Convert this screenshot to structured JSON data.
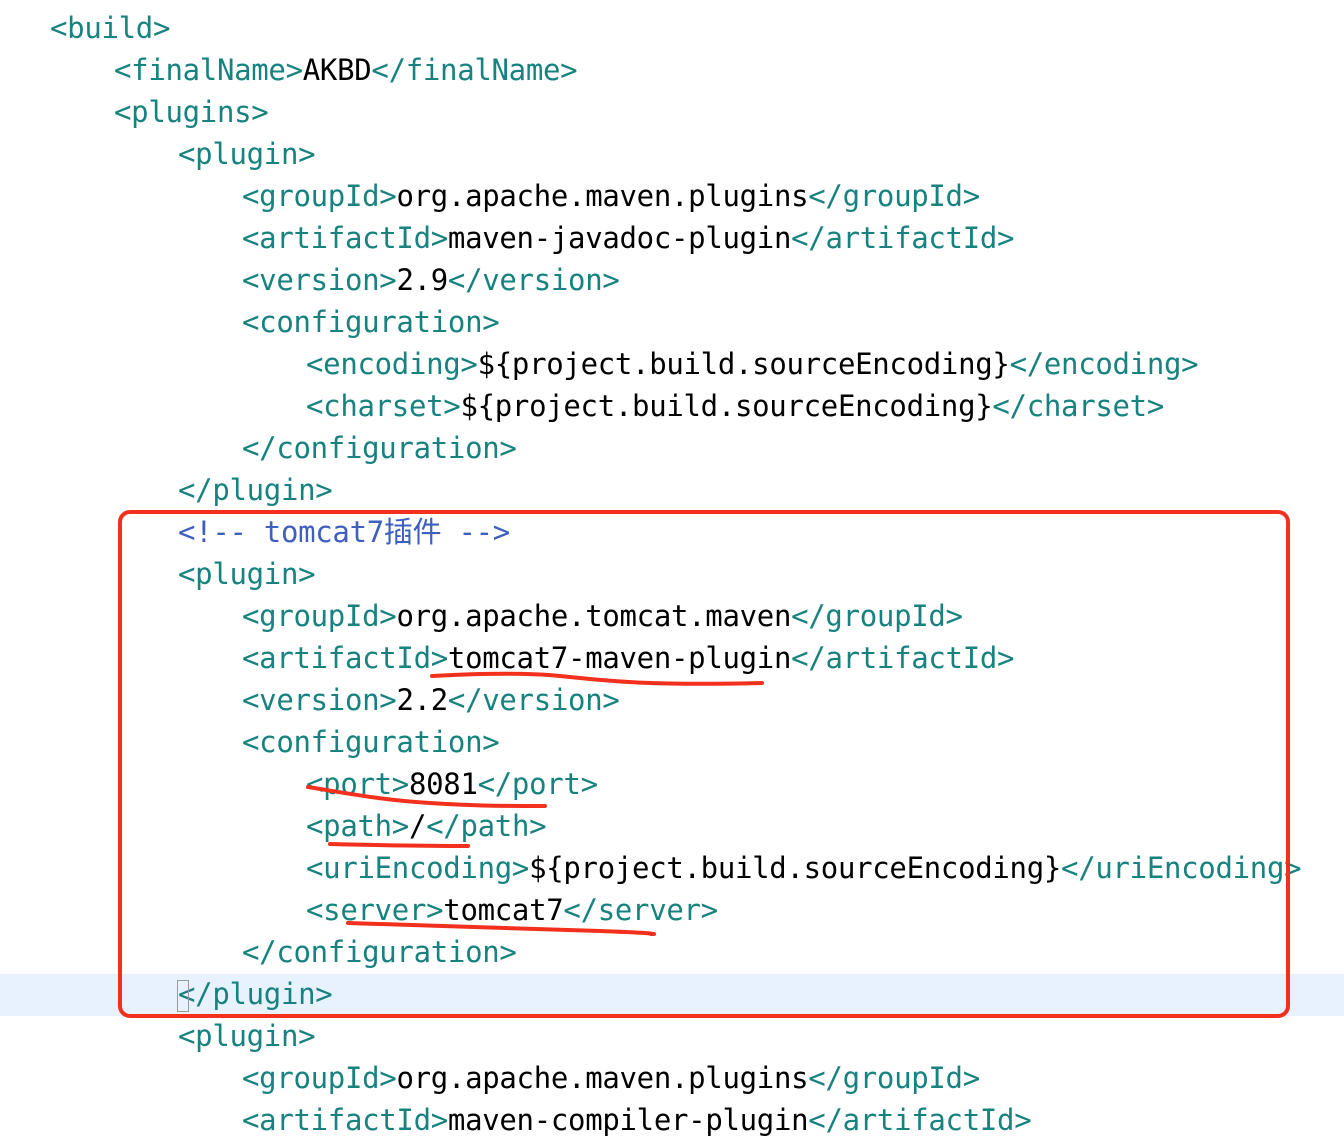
{
  "editor": {
    "lines": [
      {
        "indent": 0,
        "open": "build"
      },
      {
        "indent": 1,
        "open": "finalName",
        "value": "AKBD"
      },
      {
        "indent": 1,
        "open": "plugins"
      },
      {
        "indent": 2,
        "open": "plugin"
      },
      {
        "indent": 3,
        "open": "groupId",
        "value": "org.apache.maven.plugins"
      },
      {
        "indent": 3,
        "open": "artifactId",
        "value": "maven-javadoc-plugin"
      },
      {
        "indent": 3,
        "open": "version",
        "value": "2.9"
      },
      {
        "indent": 3,
        "open": "configuration"
      },
      {
        "indent": 4,
        "open": "encoding",
        "value": "${project.build.sourceEncoding}"
      },
      {
        "indent": 4,
        "open": "charset",
        "value": "${project.build.sourceEncoding}"
      },
      {
        "indent": 3,
        "close": "configuration"
      },
      {
        "indent": 2,
        "close": "plugin"
      },
      {
        "indent": 2,
        "comment": "<!-- tomcat7插件 -->"
      },
      {
        "indent": 2,
        "open": "plugin"
      },
      {
        "indent": 3,
        "open": "groupId",
        "value": "org.apache.tomcat.maven"
      },
      {
        "indent": 3,
        "open": "artifactId",
        "value": "tomcat7-maven-plugin"
      },
      {
        "indent": 3,
        "open": "version",
        "value": "2.2"
      },
      {
        "indent": 3,
        "open": "configuration"
      },
      {
        "indent": 4,
        "open": "port",
        "value": "8081"
      },
      {
        "indent": 4,
        "open": "path",
        "value": "/"
      },
      {
        "indent": 4,
        "open": "uriEncoding",
        "value": "${project.build.sourceEncoding}"
      },
      {
        "indent": 4,
        "open": "server",
        "value": "tomcat7"
      },
      {
        "indent": 3,
        "close": "configuration"
      },
      {
        "indent": 2,
        "close": "plugin"
      },
      {
        "indent": 2,
        "open": "plugin"
      },
      {
        "indent": 3,
        "open": "groupId",
        "value": "org.apache.maven.plugins"
      },
      {
        "indent": 3,
        "open": "artifactId",
        "value": "maven-compiler-plugin"
      }
    ],
    "current_line": 24
  },
  "colors": {
    "tag": "#17827f",
    "text": "#000000",
    "comment": "#3f5fbf",
    "annotation": "#f3301d",
    "current_line_bg": "#e8f2fe"
  },
  "annotations": {
    "box": "red-rectangle-around-tomcat7-plugin",
    "underlines": [
      "tomcat7-maven-plugin",
      "<port>8081</port>",
      "<path>/</path>",
      "<server>tomcat7</server>"
    ]
  }
}
